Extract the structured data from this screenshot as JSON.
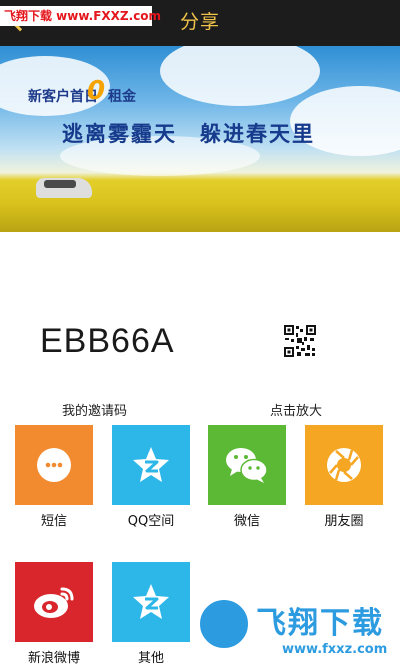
{
  "header": {
    "title": "分享"
  },
  "watermark_top": "飞翔下载 www.FXXZ.com",
  "banner": {
    "line1_prefix": "新客户首日",
    "line1_zero": "0",
    "line1_suffix": "租金",
    "line2": "逃离雾霾天　躲进春天里"
  },
  "invite": {
    "code": "EBB66A",
    "code_label": "我的邀请码",
    "zoom_label": "点击放大"
  },
  "share": {
    "items": [
      {
        "label": "短信",
        "icon": "sms-icon",
        "color": "#f28a30"
      },
      {
        "label": "QQ空间",
        "icon": "qzone-icon",
        "color": "#2db7e9"
      },
      {
        "label": "微信",
        "icon": "wechat-icon",
        "color": "#5cb935"
      },
      {
        "label": "朋友圈",
        "icon": "moments-icon",
        "color": "#f5a623"
      },
      {
        "label": "新浪微博",
        "icon": "weibo-icon",
        "color": "#d8262c"
      },
      {
        "label": "其他",
        "icon": "other-icon",
        "color": "#2db7e9"
      }
    ]
  },
  "watermark_bottom": {
    "brand": "飞翔下载",
    "url": "www.fxxz.com"
  }
}
